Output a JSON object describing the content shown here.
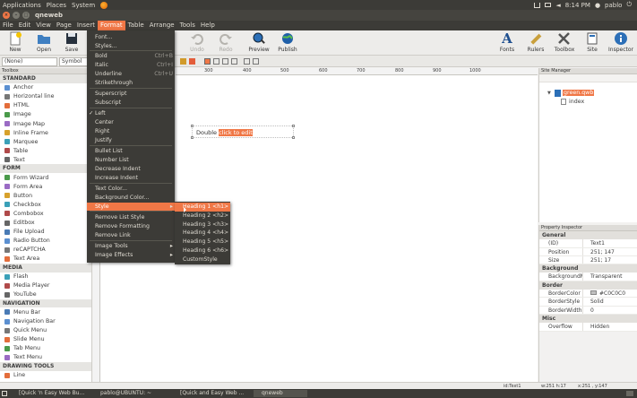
{
  "topbar": {
    "menus": [
      "Applications",
      "Places",
      "System"
    ],
    "clock": "8:14 PM",
    "user": "pablo"
  },
  "window": {
    "title": "qneweb"
  },
  "menubar": [
    "File",
    "Edit",
    "View",
    "Page",
    "Insert",
    "Format",
    "Table",
    "Arrange",
    "Tools",
    "Help"
  ],
  "toolbar": {
    "new": "New",
    "open": "Open",
    "save": "Save",
    "undo": "Undo",
    "redo": "Redo",
    "preview": "Preview",
    "publish": "Publish",
    "fonts": "Fonts",
    "rulers": "Rulers",
    "toolbox": "Toolbox",
    "site": "Site",
    "inspector": "Inspector"
  },
  "formatbar": {
    "style_value": "(None)",
    "font_value": "Symbol"
  },
  "toolbox": {
    "title": "Toolbox",
    "categories": [
      {
        "name": "STANDARD",
        "items": [
          "Anchor",
          "Horizontal line",
          "HTML",
          "Image",
          "Image Map",
          "Inline Frame",
          "Marquee",
          "Table",
          "Text"
        ]
      },
      {
        "name": "FORM",
        "items": [
          "Form Wizard",
          "Form Area",
          "Button",
          "Checkbox",
          "Combobox",
          "Editbox",
          "File Upload",
          "Radio Button",
          "reCAPTCHA",
          "Text Area"
        ]
      },
      {
        "name": "MEDIA",
        "items": [
          "Flash",
          "Media Player",
          "YouTube"
        ]
      },
      {
        "name": "NAVIGATION",
        "items": [
          "Menu Bar",
          "Navigation Bar",
          "Quick Menu",
          "Slide Menu",
          "Tab Menu",
          "Text Menu"
        ]
      },
      {
        "name": "DRAWING TOOLS",
        "items": [
          "Line"
        ]
      }
    ]
  },
  "rulers": {
    "ticks": [
      "300",
      "400",
      "500",
      "600",
      "700",
      "800",
      "900",
      "1000"
    ]
  },
  "canvas": {
    "text_plain": "Double ",
    "text_selected": "click to edit"
  },
  "format_menu": {
    "items": [
      {
        "label": "Font..."
      },
      {
        "label": "Styles..."
      },
      {
        "label": "Bold",
        "shortcut": "Ctrl+B"
      },
      {
        "label": "Italic",
        "shortcut": "Ctrl+I"
      },
      {
        "label": "Underline",
        "shortcut": "Ctrl+U"
      },
      {
        "label": "Strikethrough"
      },
      {
        "label": "Superscript"
      },
      {
        "label": "Subscript"
      },
      {
        "label": "Left",
        "check": "✓"
      },
      {
        "label": "Center"
      },
      {
        "label": "Right"
      },
      {
        "label": "Justify"
      },
      {
        "label": "Bullet List"
      },
      {
        "label": "Number List"
      },
      {
        "label": "Decrease Indent"
      },
      {
        "label": "Increase Indent"
      },
      {
        "label": "Text Color..."
      },
      {
        "label": "Background Color..."
      },
      {
        "label": "Style",
        "arrow": "▸"
      },
      {
        "label": "Remove List Style"
      },
      {
        "label": "Remove Formatting"
      },
      {
        "label": "Remove Link"
      },
      {
        "label": "Image Tools",
        "arrow": "▸"
      },
      {
        "label": "Image Effects",
        "arrow": "▸"
      }
    ]
  },
  "style_submenu": [
    "Heading 1 <h1>",
    "Heading 2 <h2>",
    "Heading 3 <h3>",
    "Heading 4 <h4>",
    "Heading 5 <h5>",
    "Heading 6 <h6>",
    "CustomStyle"
  ],
  "site_manager": {
    "title": "Site Manager",
    "root": "green.qwb",
    "child": "index"
  },
  "property_inspector": {
    "title": "Property Inspector",
    "groups": [
      {
        "name": "General",
        "rows": [
          [
            "(ID)",
            "Text1"
          ],
          [
            "Position",
            "251; 147"
          ],
          [
            "Size",
            "251; 17"
          ]
        ]
      },
      {
        "name": "Background",
        "rows": [
          [
            "BackgroundMo",
            "Transparent"
          ]
        ]
      },
      {
        "name": "Border",
        "rows": [
          [
            "BorderColor",
            "#C0C0C0"
          ],
          [
            "BorderStyle",
            "Solid"
          ],
          [
            "BorderWidth",
            "0"
          ]
        ]
      },
      {
        "name": "Misc",
        "rows": [
          [
            "Overflow",
            "Hidden"
          ]
        ]
      }
    ]
  },
  "statusbar": {
    "id": "id:Text1",
    "size": "w:251 h:17",
    "pos": "x:251 , y:147"
  },
  "taskbar": [
    "[Quick 'n Easy Web Bu...",
    "pablo@UBUNTU: ~",
    "[Quick and Easy Web ...",
    "qneweb"
  ],
  "colors": {
    "accent": "#f07746",
    "menu_bg": "#3c3b37",
    "panel_bg": "#f2f1f0"
  }
}
